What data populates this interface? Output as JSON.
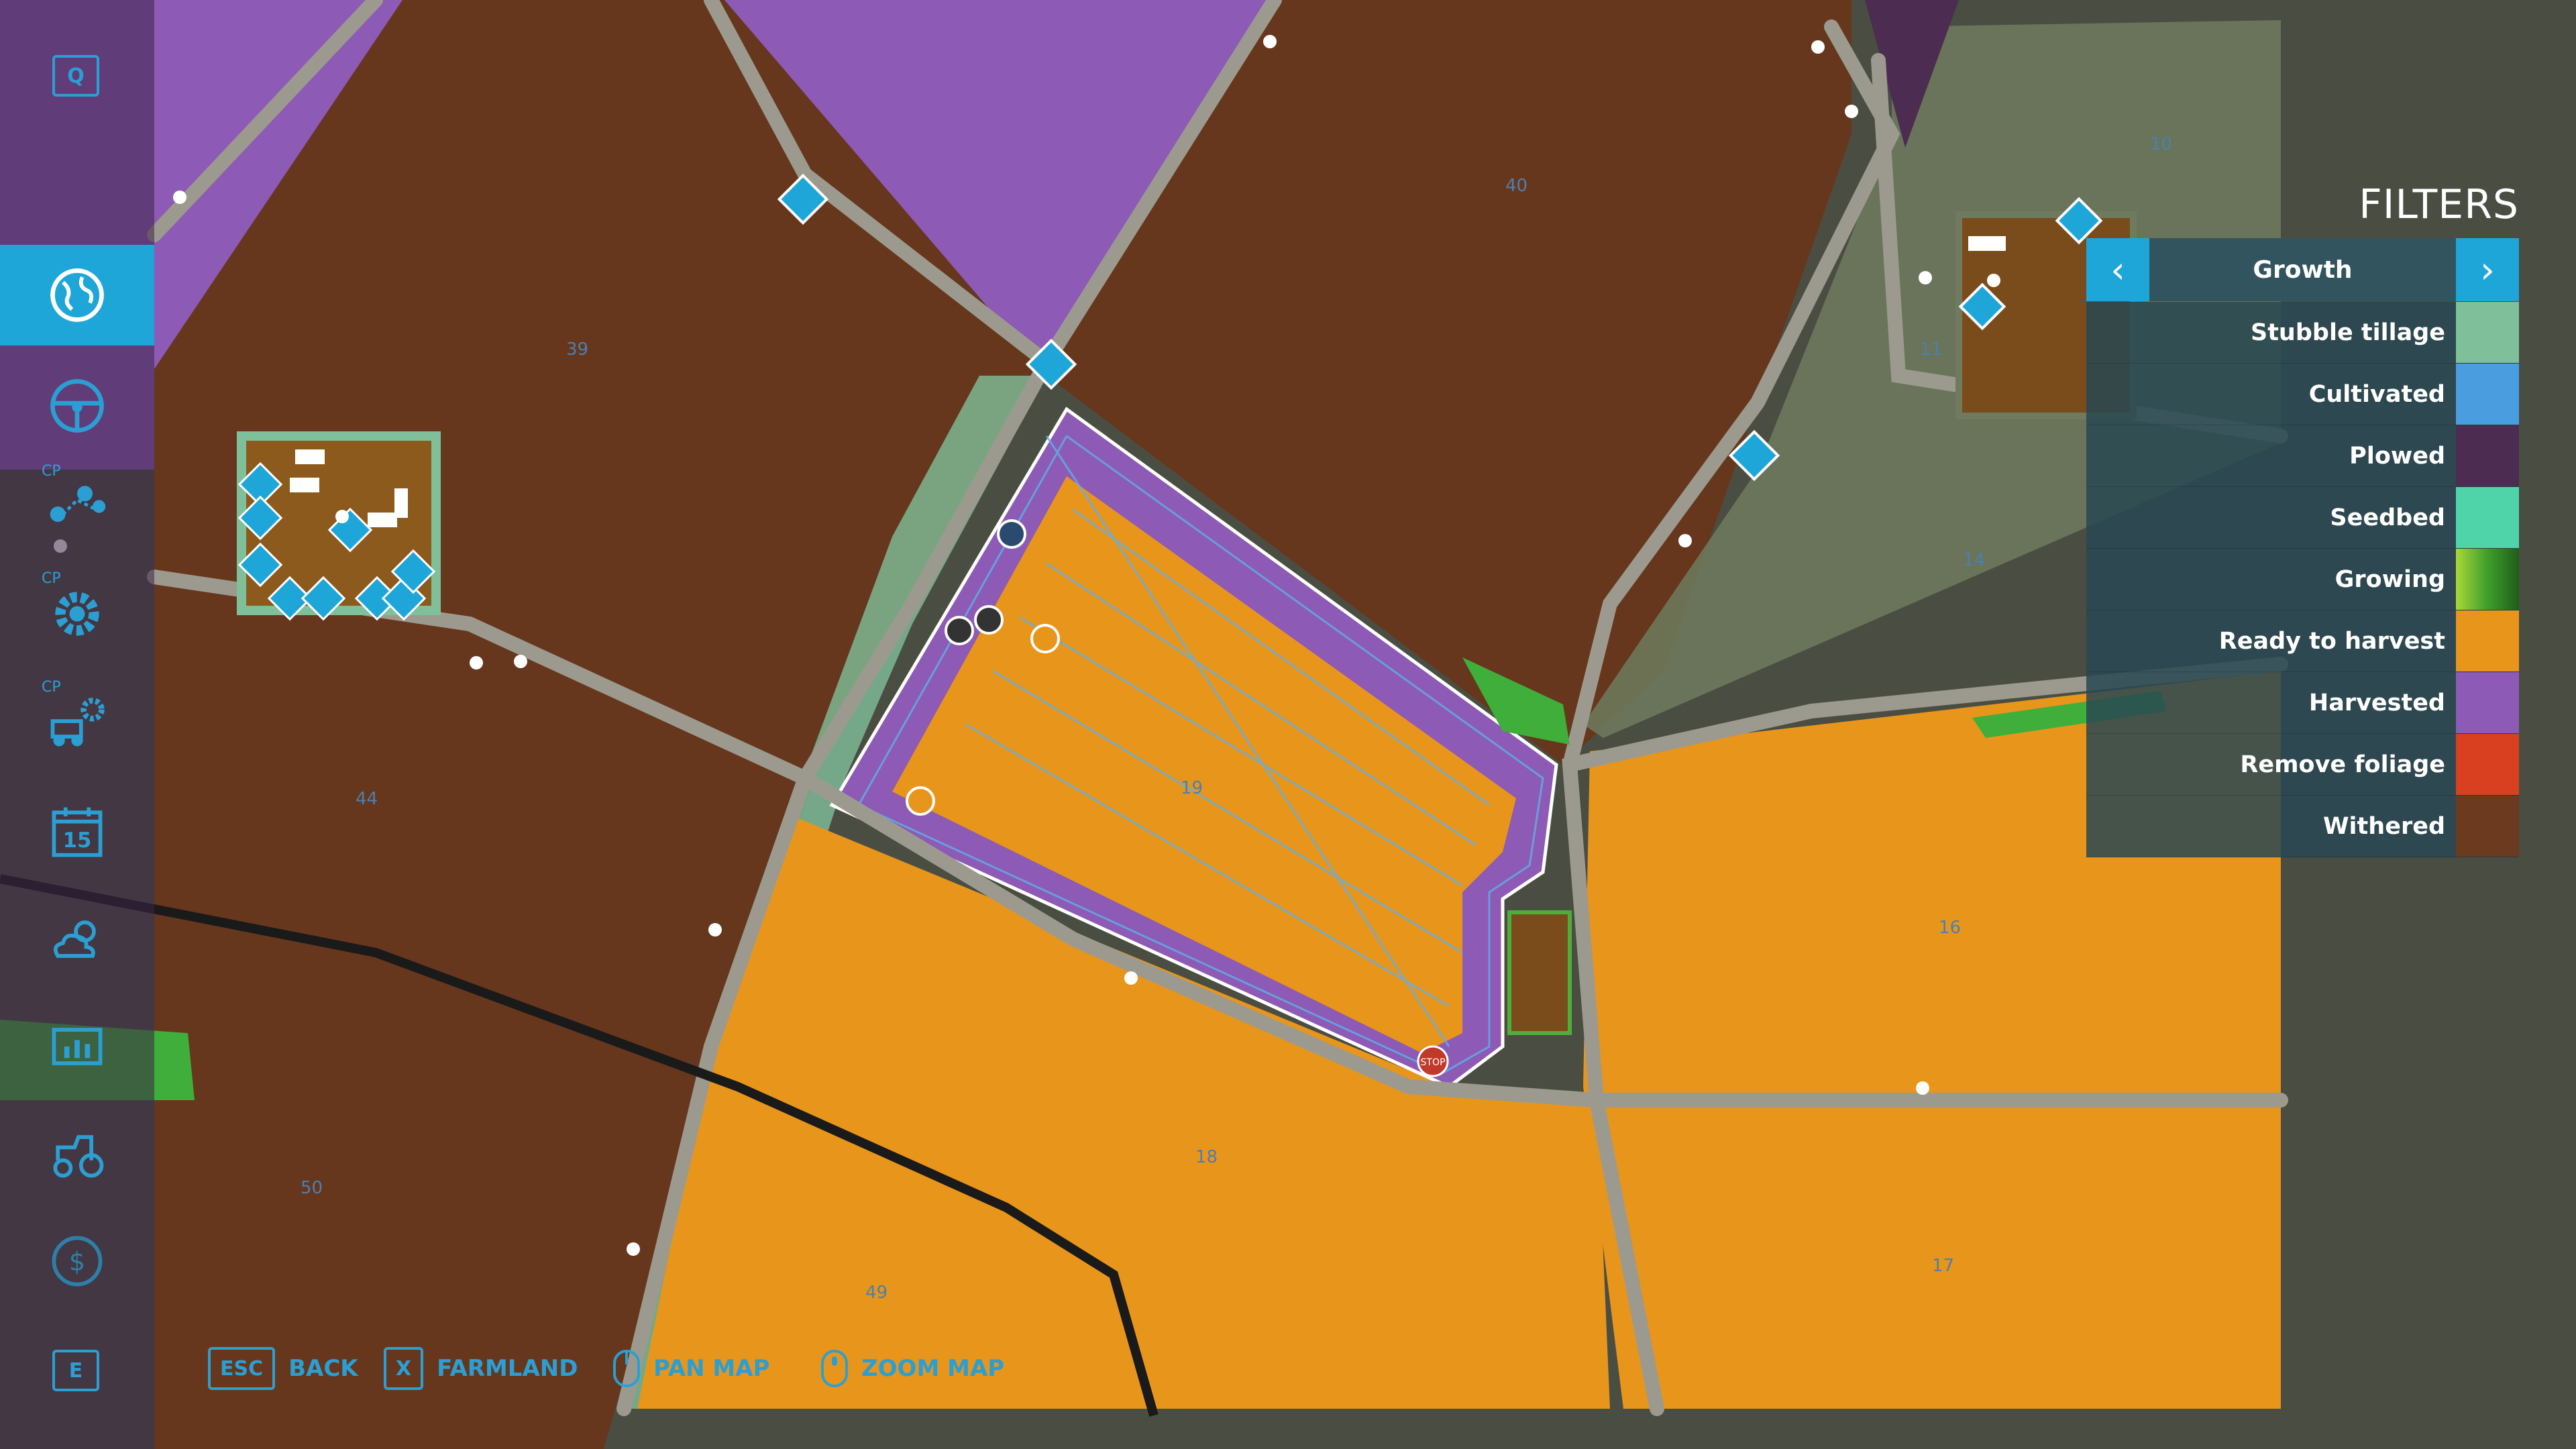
{
  "sidebar": {
    "top_key": "Q",
    "bottom_key": "E",
    "cp_label": "CP",
    "items": [
      {
        "icon": "globe-map-icon",
        "active": true
      },
      {
        "icon": "steering-wheel-icon",
        "active": false
      },
      {
        "icon": "route-pins-icon",
        "active": false
      },
      {
        "icon": "production-gear-icon",
        "active": false
      },
      {
        "icon": "vehicle-gear-icon",
        "active": false
      },
      {
        "icon": "calendar-icon",
        "active": false,
        "text": "15"
      },
      {
        "icon": "weather-icon",
        "active": false
      },
      {
        "icon": "statistics-icon",
        "active": false
      },
      {
        "icon": "tractor-icon",
        "active": false
      },
      {
        "icon": "dollar-icon",
        "active": false
      }
    ]
  },
  "filters": {
    "title": "FILTERS",
    "current": "Growth",
    "prev_symbol": "‹",
    "next_symbol": "›",
    "legend": [
      {
        "label": "Stubble tillage",
        "color": "#7fbf9a"
      },
      {
        "label": "Cultivated",
        "color": "#4a9ee0"
      },
      {
        "label": "Plowed",
        "color": "#4c2c50"
      },
      {
        "label": "Seedbed",
        "color": "#4fd4aa"
      },
      {
        "label": "Growing",
        "color": "gradient"
      },
      {
        "label": "Ready to harvest",
        "color": "#e8951c"
      },
      {
        "label": "Harvested",
        "color": "#8d5ab5"
      },
      {
        "label": "Remove foliage",
        "color": "#d9401f"
      },
      {
        "label": "Withered",
        "color": "#6b3a1f"
      }
    ]
  },
  "bottom_hints": [
    {
      "key": "ESC",
      "label": "BACK",
      "type": "key"
    },
    {
      "key": "X",
      "label": "FARMLAND",
      "type": "key"
    },
    {
      "key": "",
      "label": "PAN MAP",
      "type": "mouse"
    },
    {
      "key": "",
      "label": "ZOOM MAP",
      "type": "mouse"
    }
  ],
  "map": {
    "colors": {
      "harvested": "#8d5ab5",
      "ready": "#e8951c",
      "withered": "#6b3a1f",
      "stubble": "#7fbf9a",
      "road": "#9c9a8e",
      "grass": "#4a4f43",
      "growing": "#3fae3a"
    },
    "field_numbers": [
      "10",
      "40",
      "39",
      "11",
      "14",
      "19",
      "44",
      "16",
      "18",
      "50",
      "49",
      "17"
    ],
    "stop_sign": "STOP"
  }
}
